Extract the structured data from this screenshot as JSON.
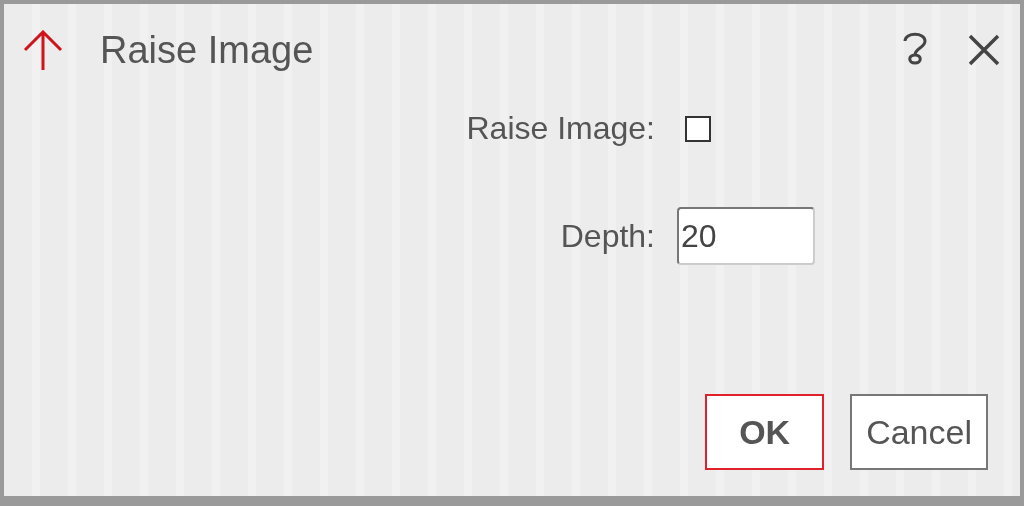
{
  "dialog": {
    "title": "Raise Image"
  },
  "fields": [
    {
      "kind": "checkbox",
      "label": "Raise Image:",
      "checked": false
    },
    {
      "kind": "number",
      "label": "Depth:",
      "value": "20"
    }
  ],
  "buttons": [
    {
      "label": "OK",
      "default": true
    },
    {
      "label": "Cancel",
      "default": false
    }
  ]
}
